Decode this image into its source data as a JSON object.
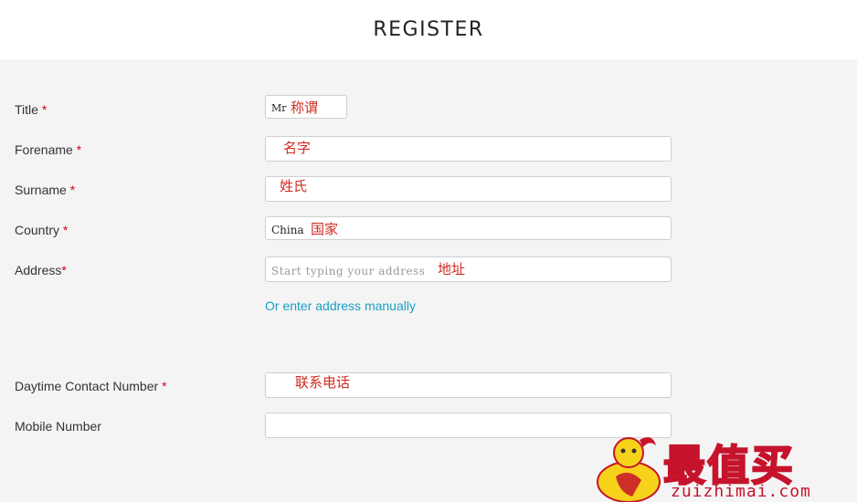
{
  "header": {
    "title": "REGISTER"
  },
  "form": {
    "title": {
      "label": "Title",
      "required_mark": "*",
      "value": "Mr",
      "note": "称谓"
    },
    "forename": {
      "label": "Forename",
      "required_mark": "*",
      "value": "",
      "note": "名字"
    },
    "surname": {
      "label": "Surname",
      "required_mark": "*",
      "value": "",
      "note": "姓氏"
    },
    "country": {
      "label": "Country",
      "required_mark": "*",
      "value": "China",
      "note": "国家"
    },
    "address": {
      "label": "Address",
      "required_mark": "*",
      "placeholder": "Start typing your address",
      "note": "地址"
    },
    "manual_address_link": "Or enter address manually",
    "daytime_contact": {
      "label": "Daytime Contact Number",
      "required_mark": "*",
      "value": "",
      "note": "联系电话"
    },
    "mobile": {
      "label": "Mobile Number",
      "value": ""
    }
  },
  "watermark": {
    "name_cn": "最值买",
    "domain": "zuizhimai.com",
    "colors": {
      "fill": "#f7d21a",
      "stroke": "#c6132c"
    }
  }
}
